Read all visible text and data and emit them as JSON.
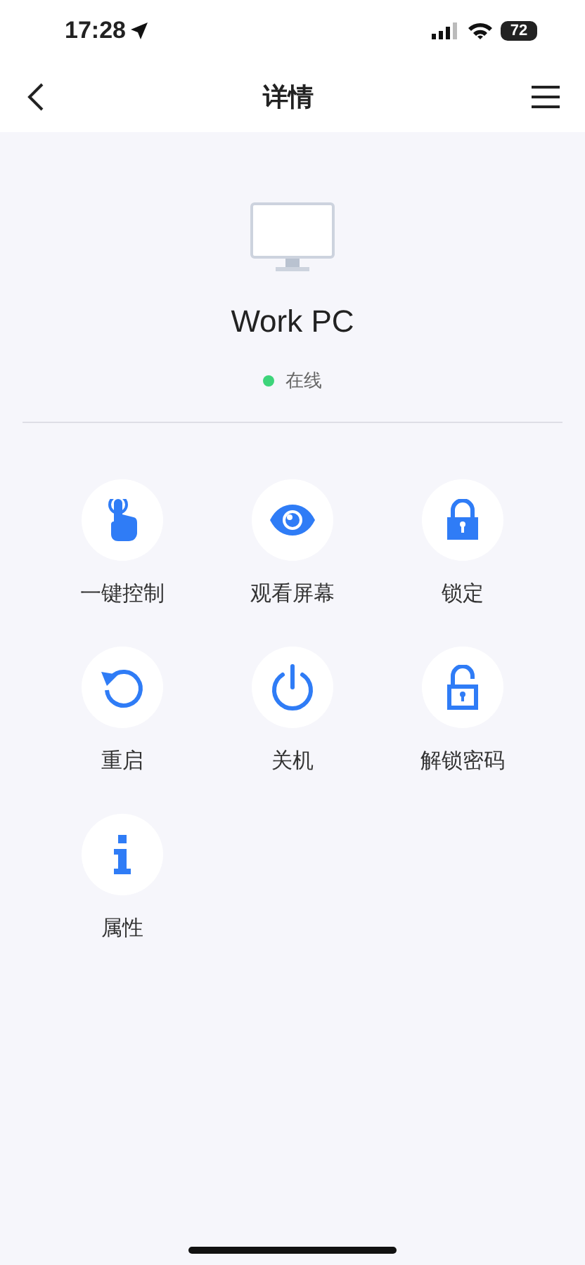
{
  "status_bar": {
    "time": "17:28",
    "battery": "72"
  },
  "nav": {
    "title": "详情"
  },
  "device": {
    "name": "Work PC",
    "status": {
      "label": "在线",
      "color": "#3dd47a"
    }
  },
  "actions": [
    {
      "kind": "touch",
      "label": "一键控制"
    },
    {
      "kind": "eye",
      "label": "观看屏幕"
    },
    {
      "kind": "lock",
      "label": "锁定"
    },
    {
      "kind": "restart",
      "label": "重启"
    },
    {
      "kind": "power",
      "label": "关机"
    },
    {
      "kind": "unlock",
      "label": "解锁密码"
    },
    {
      "kind": "info",
      "label": "属性"
    }
  ]
}
